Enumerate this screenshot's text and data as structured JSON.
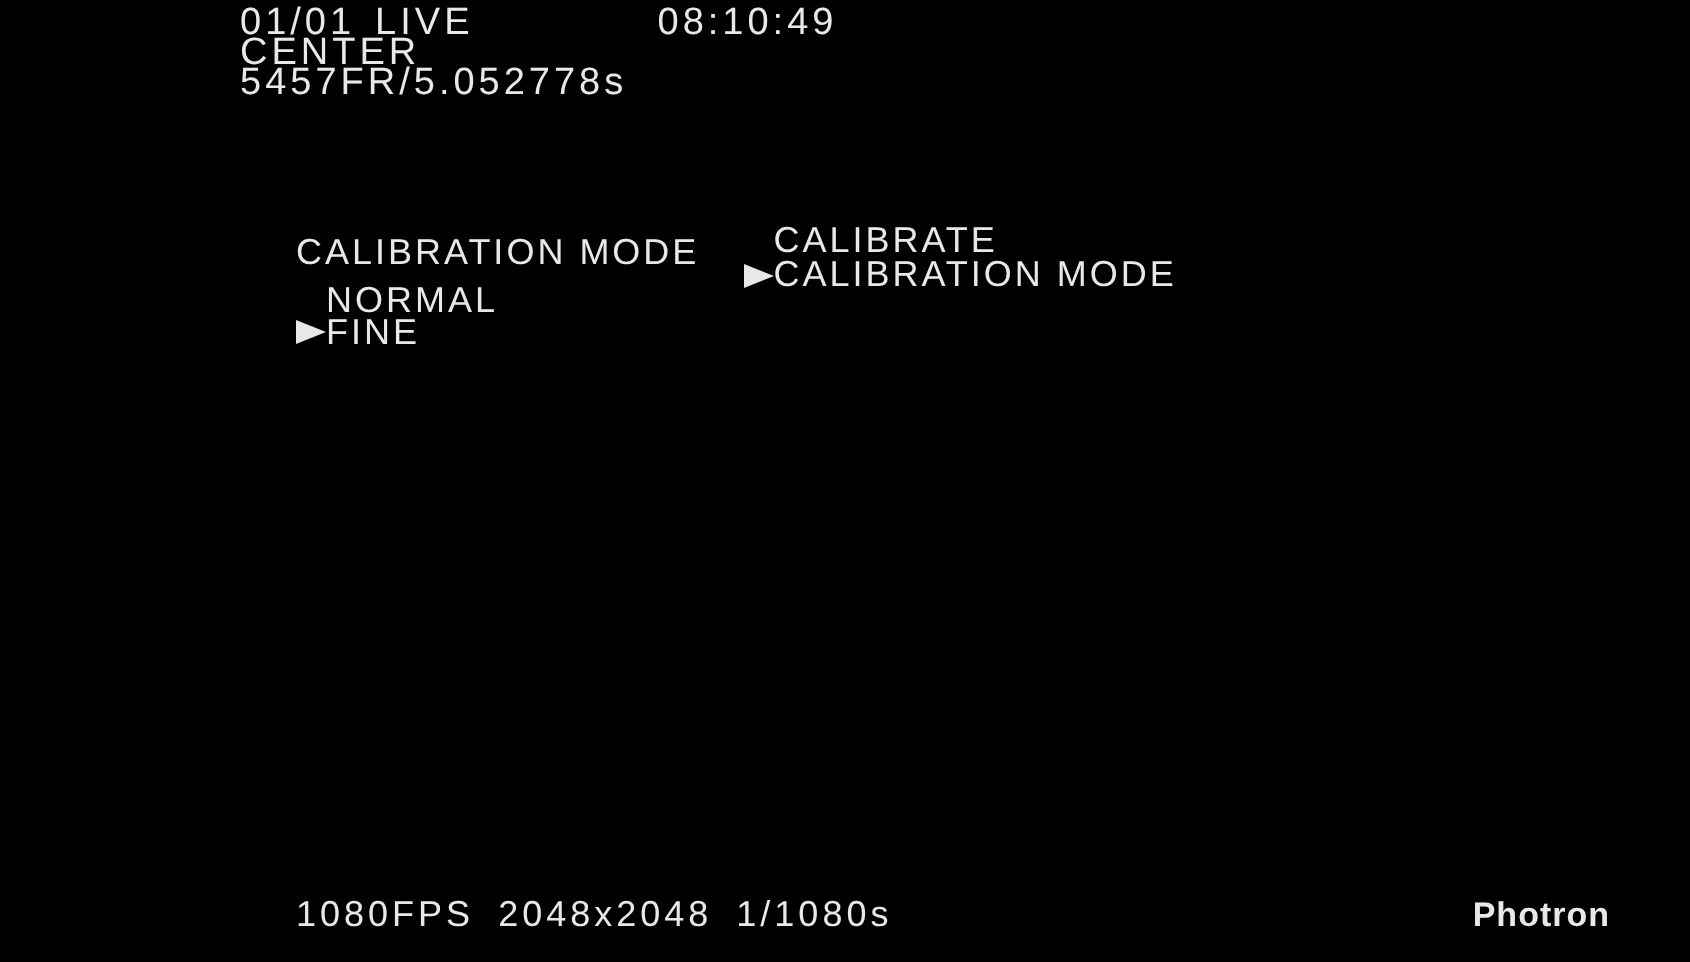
{
  "status": {
    "date": "01/01",
    "mode": "LIVE",
    "time": "08:10:49",
    "trigger": "CENTER",
    "frame": "5457FR/5.052778s"
  },
  "menu": {
    "title": "CALIBRATION MODE",
    "path": [
      {
        "label": "CALIBRATE",
        "selected": false
      },
      {
        "label": "CALIBRATION MODE",
        "selected": true
      }
    ],
    "options": [
      {
        "label": "NORMAL",
        "selected": false
      },
      {
        "label": "FINE",
        "selected": true
      }
    ]
  },
  "footer": {
    "rate": "1080FPS",
    "resolution": "2048x2048",
    "shutter": "1/1080s",
    "brand": "Photron"
  }
}
